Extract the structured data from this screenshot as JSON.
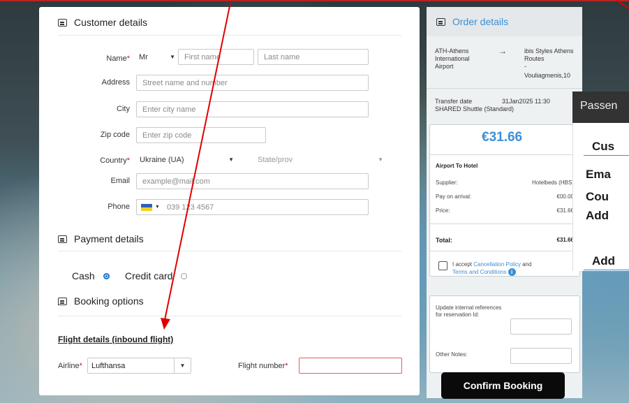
{
  "customer": {
    "title": "Customer details",
    "name_label": "Name",
    "title_value": "Mr",
    "first_name_placeholder": "First name",
    "last_name_placeholder": "Last name",
    "address_label": "Address",
    "address_placeholder": "Street name and number",
    "city_label": "City",
    "city_placeholder": "Enter city name",
    "zip_label": "Zip code",
    "zip_placeholder": "Enter zip code",
    "country_label": "Country",
    "country_value": "Ukraine (UA)",
    "state_placeholder": "State/prov",
    "email_label": "Email",
    "email_placeholder": "example@mail.com",
    "phone_label": "Phone",
    "phone_placeholder": "039 123 4567",
    "required_mark": "*"
  },
  "payment": {
    "title": "Payment details",
    "cash_label": "Cash",
    "credit_label": "Credit card"
  },
  "booking": {
    "title": "Booking options",
    "flight_title": "Flight details (inbound flight)",
    "airline_label": "Airline",
    "airline_value": "Lufthansa",
    "flight_number_label": "Flight number"
  },
  "order": {
    "title": "Order details",
    "from": "ATH-Athens International Airport",
    "arrow": "→",
    "to_line1": "ibis Styles Athens Routes",
    "to_line2": "-",
    "to_line3": "Vouliagmenis,10",
    "transfer_label": "Transfer date",
    "transfer_value": "31Jan2025 11:30",
    "service": "SHARED Shuttle (Standard)",
    "price": "€31.66",
    "direction": "Airport To Hotel",
    "supplier_label": "Supplier:",
    "supplier_value": "Hotelbeds (HBS)",
    "pay_arrival_label": "Pay on arrival:",
    "pay_arrival_value": "€00.00",
    "price_label": "Price:",
    "price_value": "€31.66",
    "total_label": "Total:",
    "total_value": "€31.66",
    "accept_text": "I accept",
    "cancellation_link": "Cancellation Policy",
    "and_text": "and",
    "terms_link": "Terms and Conditions",
    "internal_refs_label": "Update internal references for reservation Id:",
    "other_notes_label": "Other Notes:",
    "confirm_label": "Confirm Booking"
  },
  "passenger_overlay": {
    "header": "Passen",
    "line1": "Cus",
    "line2": "Ema",
    "line3": "Cou",
    "line4": "Add",
    "line5": "Add"
  },
  "colors": {
    "accent": "#3b8fd6",
    "required": "#c8102e",
    "annotation": "#e00000"
  }
}
